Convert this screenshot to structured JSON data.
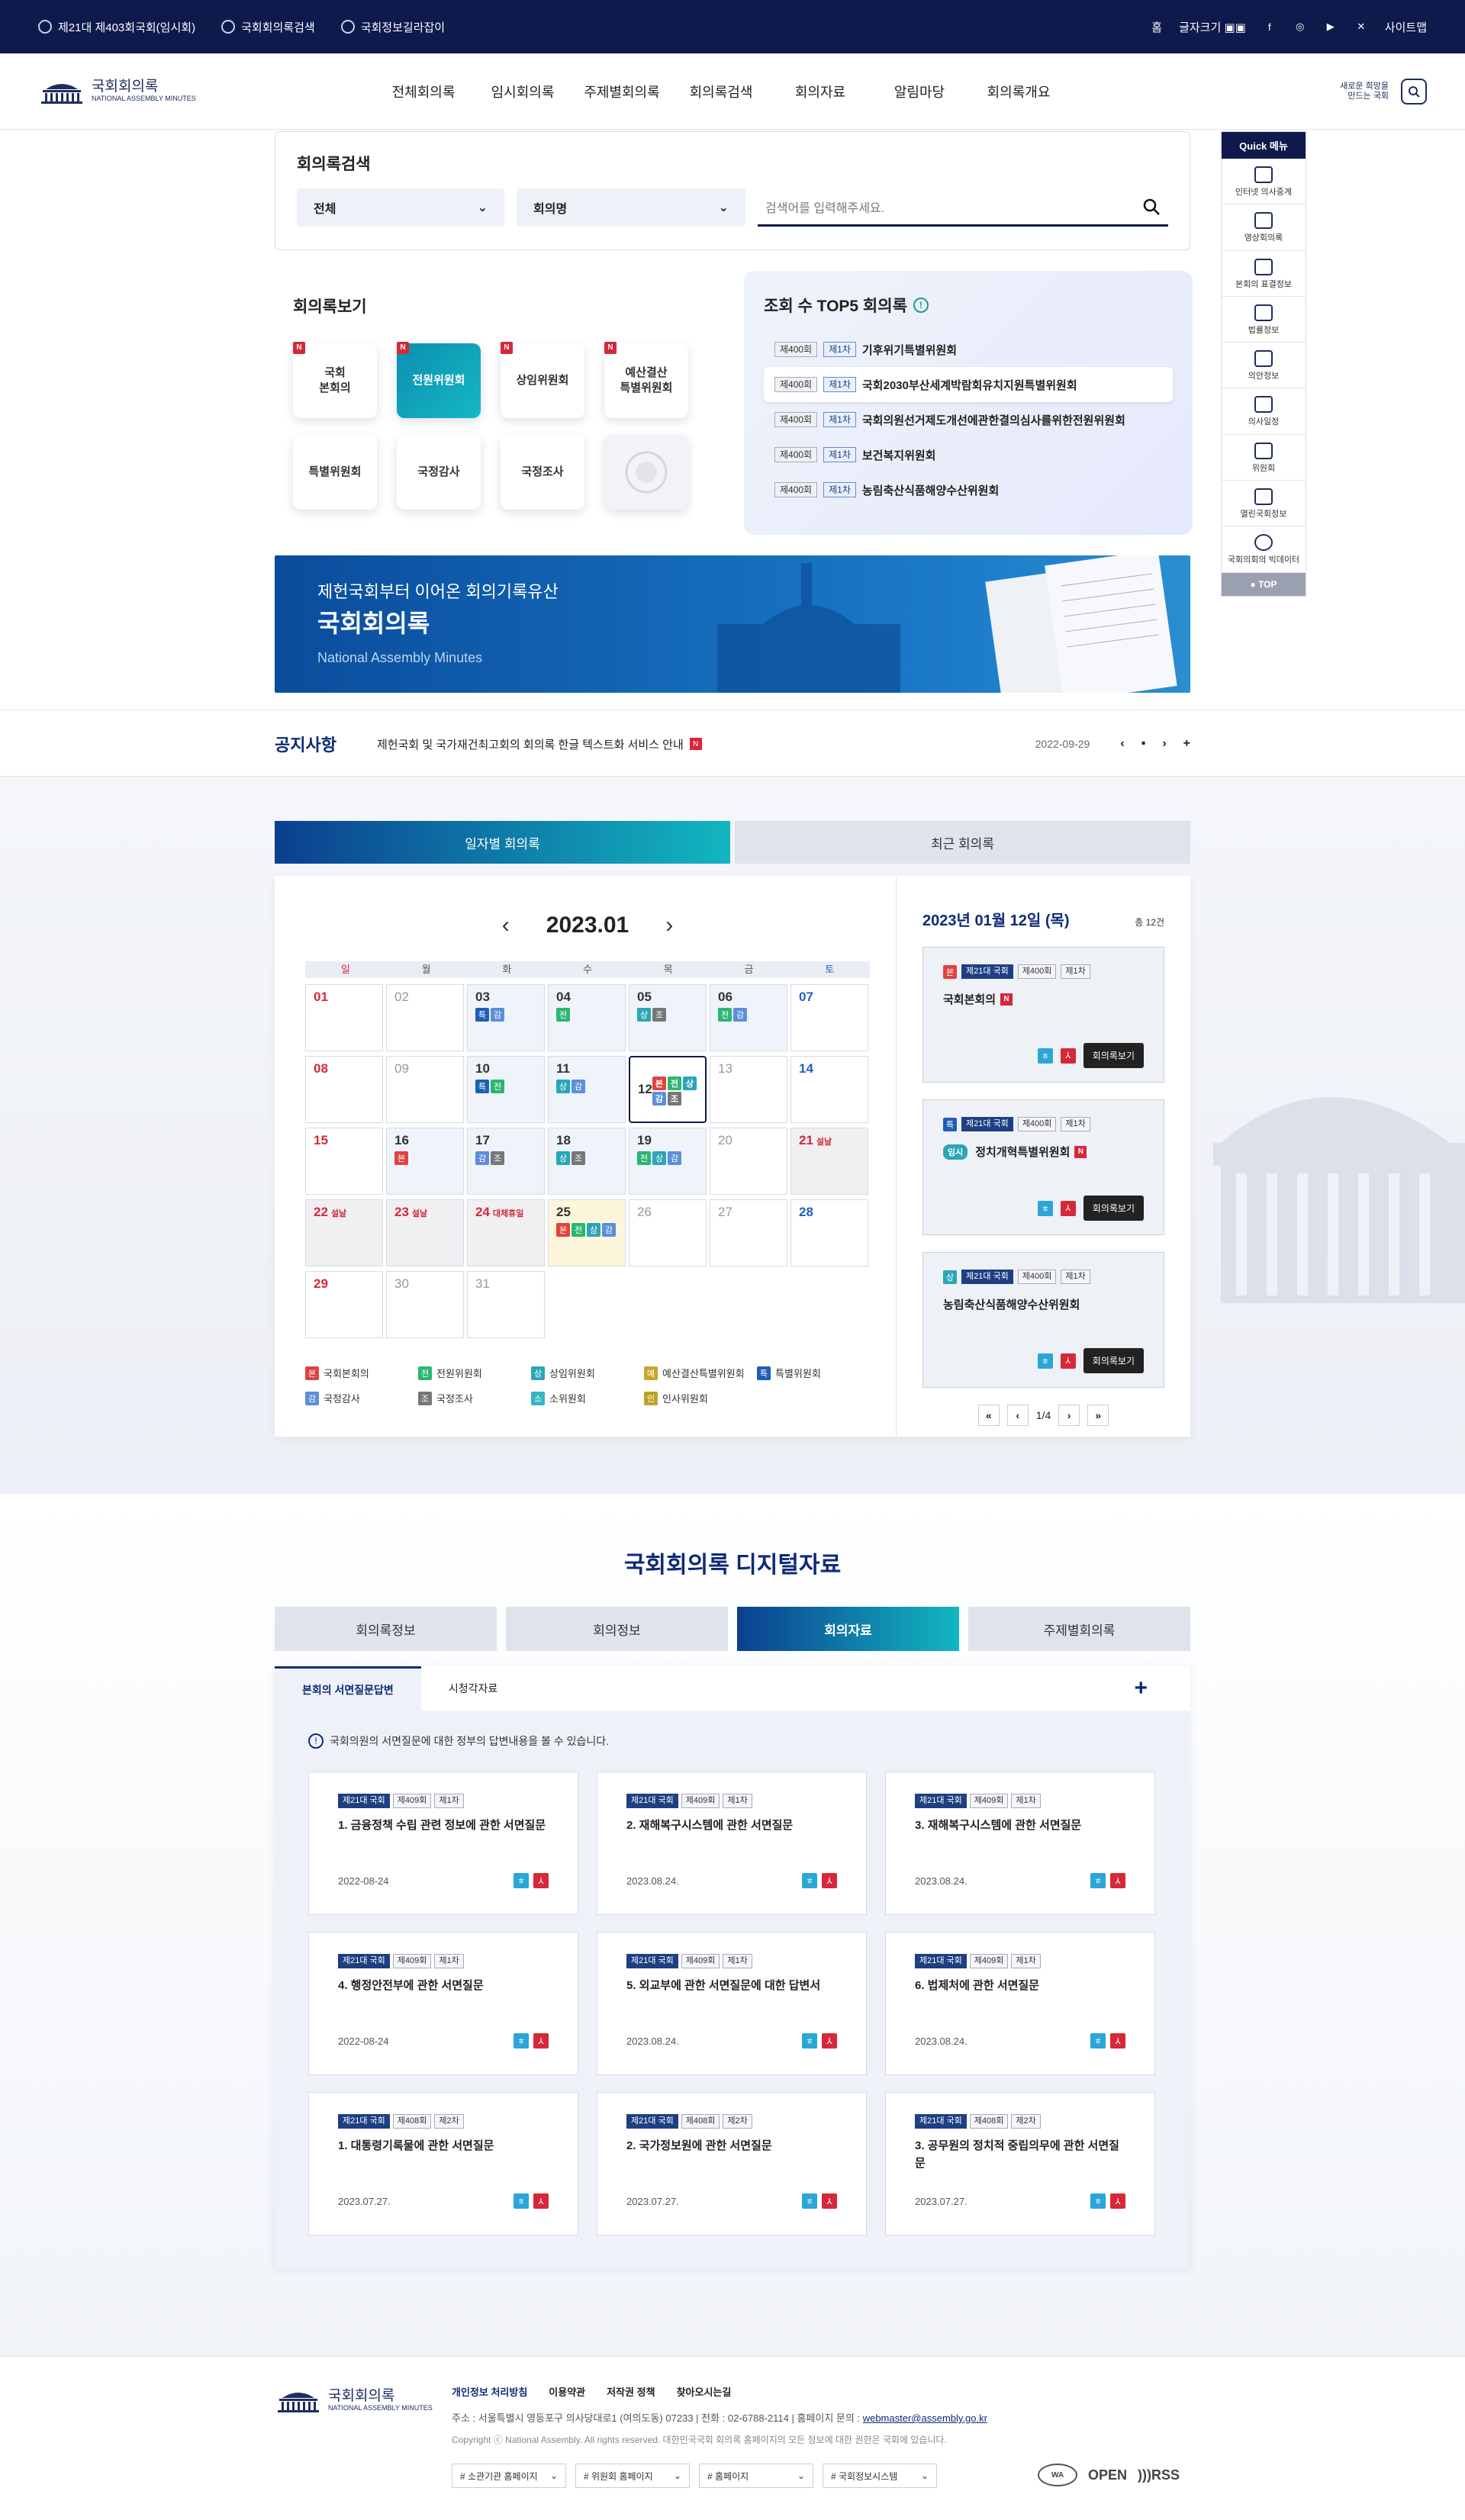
{
  "topbar": {
    "links": [
      "제21대 제403회국회(임시회)",
      "국회회의록검색",
      "국회정보길라잡이"
    ],
    "home": "홈",
    "font_size": "글자크기",
    "sitemap": "사이트맵"
  },
  "header": {
    "logo": {
      "name": "국회회의록",
      "sub": "NATIONAL ASSEMBLY MINUTES"
    },
    "menu": [
      "전체회의록",
      "임시회의록",
      "주제별회의록",
      "회의록검색",
      "회의자료",
      "알림마당",
      "회의록개요"
    ],
    "slogan": [
      "새로운 희망을",
      "만드는 국회"
    ]
  },
  "search": {
    "title": "회의록검색",
    "select1": "전체",
    "select2": "회의명",
    "placeholder": "검색어를 입력해주세요."
  },
  "view": {
    "title": "회의록보기",
    "categories": [
      {
        "label": "국회\n본회의",
        "new": "N"
      },
      {
        "label": "전원위원회",
        "new": "N"
      },
      {
        "label": "상임위원회",
        "new": "N"
      },
      {
        "label": "예산결산\n특별위원회",
        "new": "N"
      },
      {
        "label": "특별위원회"
      },
      {
        "label": "국정감사"
      },
      {
        "label": "국정조사"
      }
    ]
  },
  "top5": {
    "title": "조회 수 TOP5 회의록",
    "items": [
      {
        "session": "제400회",
        "order": "제1차",
        "name": "기후위기특별위원회"
      },
      {
        "session": "제400회",
        "order": "제1차",
        "name": "국회2030부산세계박람회유치지원특별위원회"
      },
      {
        "session": "제400회",
        "order": "제1차",
        "name": "국회의원선거제도개선에관한결의심사를위한전원위원회"
      },
      {
        "session": "제400회",
        "order": "제1차",
        "name": "보건복지위원회"
      },
      {
        "session": "제400회",
        "order": "제1차",
        "name": "농림축산식품해양수산위원회"
      }
    ]
  },
  "banner": {
    "line1": "제헌국회부터 이어온 회의기록유산",
    "line2": "국회회의록",
    "line3": "National Assembly Minutes"
  },
  "notice": {
    "title": "공지사항",
    "text": "제헌국회 및 국가재건최고회의 회의록 한글 텍스트화 서비스 안내",
    "badge": "N",
    "date": "2022-09-29"
  },
  "calendar": {
    "tabs": [
      "일자별 회의록",
      "최근 회의록"
    ],
    "month": "2023.01",
    "weekdays": [
      "일",
      "월",
      "화",
      "수",
      "목",
      "금",
      "토"
    ],
    "legend": [
      {
        "chip": "본",
        "label": "국회본회의",
        "color": "#e0433f"
      },
      {
        "chip": "전",
        "label": "전원위원회",
        "color": "#2bb673"
      },
      {
        "chip": "상",
        "label": "상임위원회",
        "color": "#2aa6b8"
      },
      {
        "chip": "예",
        "label": "예산결산특별위원회",
        "color": "#c9a52c"
      },
      {
        "chip": "특",
        "label": "특별위원회",
        "color": "#1e5fb4"
      },
      {
        "chip": "감",
        "label": "국정감사",
        "color": "#5c8fd8"
      },
      {
        "chip": "조",
        "label": "국정조사",
        "color": "#777777"
      },
      {
        "chip": "소",
        "label": "소위원회",
        "color": "#34b6c4"
      },
      {
        "chip": "인",
        "label": "인사위원회",
        "color": "#b8a42a"
      }
    ],
    "detail": {
      "date": "2023년 01월 12일 (목)",
      "total": "총 12건",
      "cards": [
        {
          "badge": "본",
          "badge_color": "#e0433f",
          "assembly": "제21대 국회",
          "session": "제400회",
          "order": "제1차",
          "name": "국회본회의",
          "prefix": ""
        },
        {
          "badge": "특",
          "badge_color": "#1e5fb4",
          "assembly": "제21대 국회",
          "session": "제400회",
          "order": "제1차",
          "name": "정치개혁특별위원회",
          "prefix": "임시"
        },
        {
          "badge": "상",
          "badge_color": "#2aa6b8",
          "assembly": "제21대 국회",
          "session": "제400회",
          "order": "제1차",
          "name": "농림축산식품해양수산위원회",
          "prefix": ""
        }
      ],
      "view_label": "회의록보기",
      "page": "1/4"
    }
  },
  "digital": {
    "title": "국회회의록 디지털자료",
    "tabs": [
      "회의록정보",
      "회의정보",
      "회의자료",
      "주제별회의록"
    ],
    "subtabs": [
      "본회의 서면질문답변",
      "시청각자료"
    ],
    "note": "국회의원의 서면질문에 대한 정부의 답변내용을 볼 수 있습니다.",
    "cards": [
      {
        "assembly": "제21대 국회",
        "session": "제409회",
        "order": "제1차",
        "title": "1. 금융정책 수립 관련 정보에 관한 서면질문",
        "date": "2022-08-24"
      },
      {
        "assembly": "제21대 국회",
        "session": "제409회",
        "order": "제1차",
        "title": "2. 재해복구시스템에 관한 서면질문",
        "date": "2023.08.24."
      },
      {
        "assembly": "제21대 국회",
        "session": "제409회",
        "order": "제1차",
        "title": "3. 재해복구시스템에 관한 서면질문",
        "date": "2023.08.24."
      },
      {
        "assembly": "제21대 국회",
        "session": "제409회",
        "order": "제1차",
        "title": "4. 행정안전부에 관한 서면질문",
        "date": "2022-08-24"
      },
      {
        "assembly": "제21대 국회",
        "session": "제409회",
        "order": "제1차",
        "title": "5. 외교부에 관한 서면질문에 대한 답변서",
        "date": "2023.08.24."
      },
      {
        "assembly": "제21대 국회",
        "session": "제409회",
        "order": "제1차",
        "title": "6. 법제처에 관한 서면질문",
        "date": "2023.08.24."
      },
      {
        "assembly": "제21대 국회",
        "session": "제408회",
        "order": "제2차",
        "title": "1. 대통령기록물에 관한 서면질문",
        "date": "2023.07.27."
      },
      {
        "assembly": "제21대 국회",
        "session": "제408회",
        "order": "제2차",
        "title": "2. 국가정보원에 관한 서면질문",
        "date": "2023.07.27."
      },
      {
        "assembly": "제21대 국회",
        "session": "제408회",
        "order": "제2차",
        "title": "3. 공무원의 정치적 중립의무에 관한 서면질문",
        "date": "2023.07.27."
      }
    ]
  },
  "quick": {
    "title": "Quick 메뉴",
    "items": [
      "인터넷 의사중계",
      "영상회의록",
      "본회의 표결정보",
      "법률정보",
      "의안정보",
      "의사일정",
      "위원회",
      "열린국회정보",
      "국회의회의 빅데이터"
    ],
    "top": "TOP"
  },
  "footer": {
    "logo": "국회회의록",
    "links": [
      "개인정보 처리방침",
      "이용약관",
      "저작권 정책",
      "찾아오시는길"
    ],
    "address": "주소 : 서울특별시 영등포구 의사당대로1 (여의도동) 07233   |   전화 : 02-6788-2114   |   홈페이지 문의 :",
    "email": "webmaster@assembly.go.kr",
    "copyright": "Copyright ⓒ National Assembly. All rights reserved. 대한민국국회 회의록 홈페이지의 모든 정보에 대한 권한은 국회에 있습니다.",
    "selects": [
      "# 소관기관 홈페이지",
      "# 위원회 홈페이지",
      "# 홈페이지",
      "# 국회정보시스템"
    ],
    "badges": [
      "OPEN",
      "RSS"
    ]
  }
}
